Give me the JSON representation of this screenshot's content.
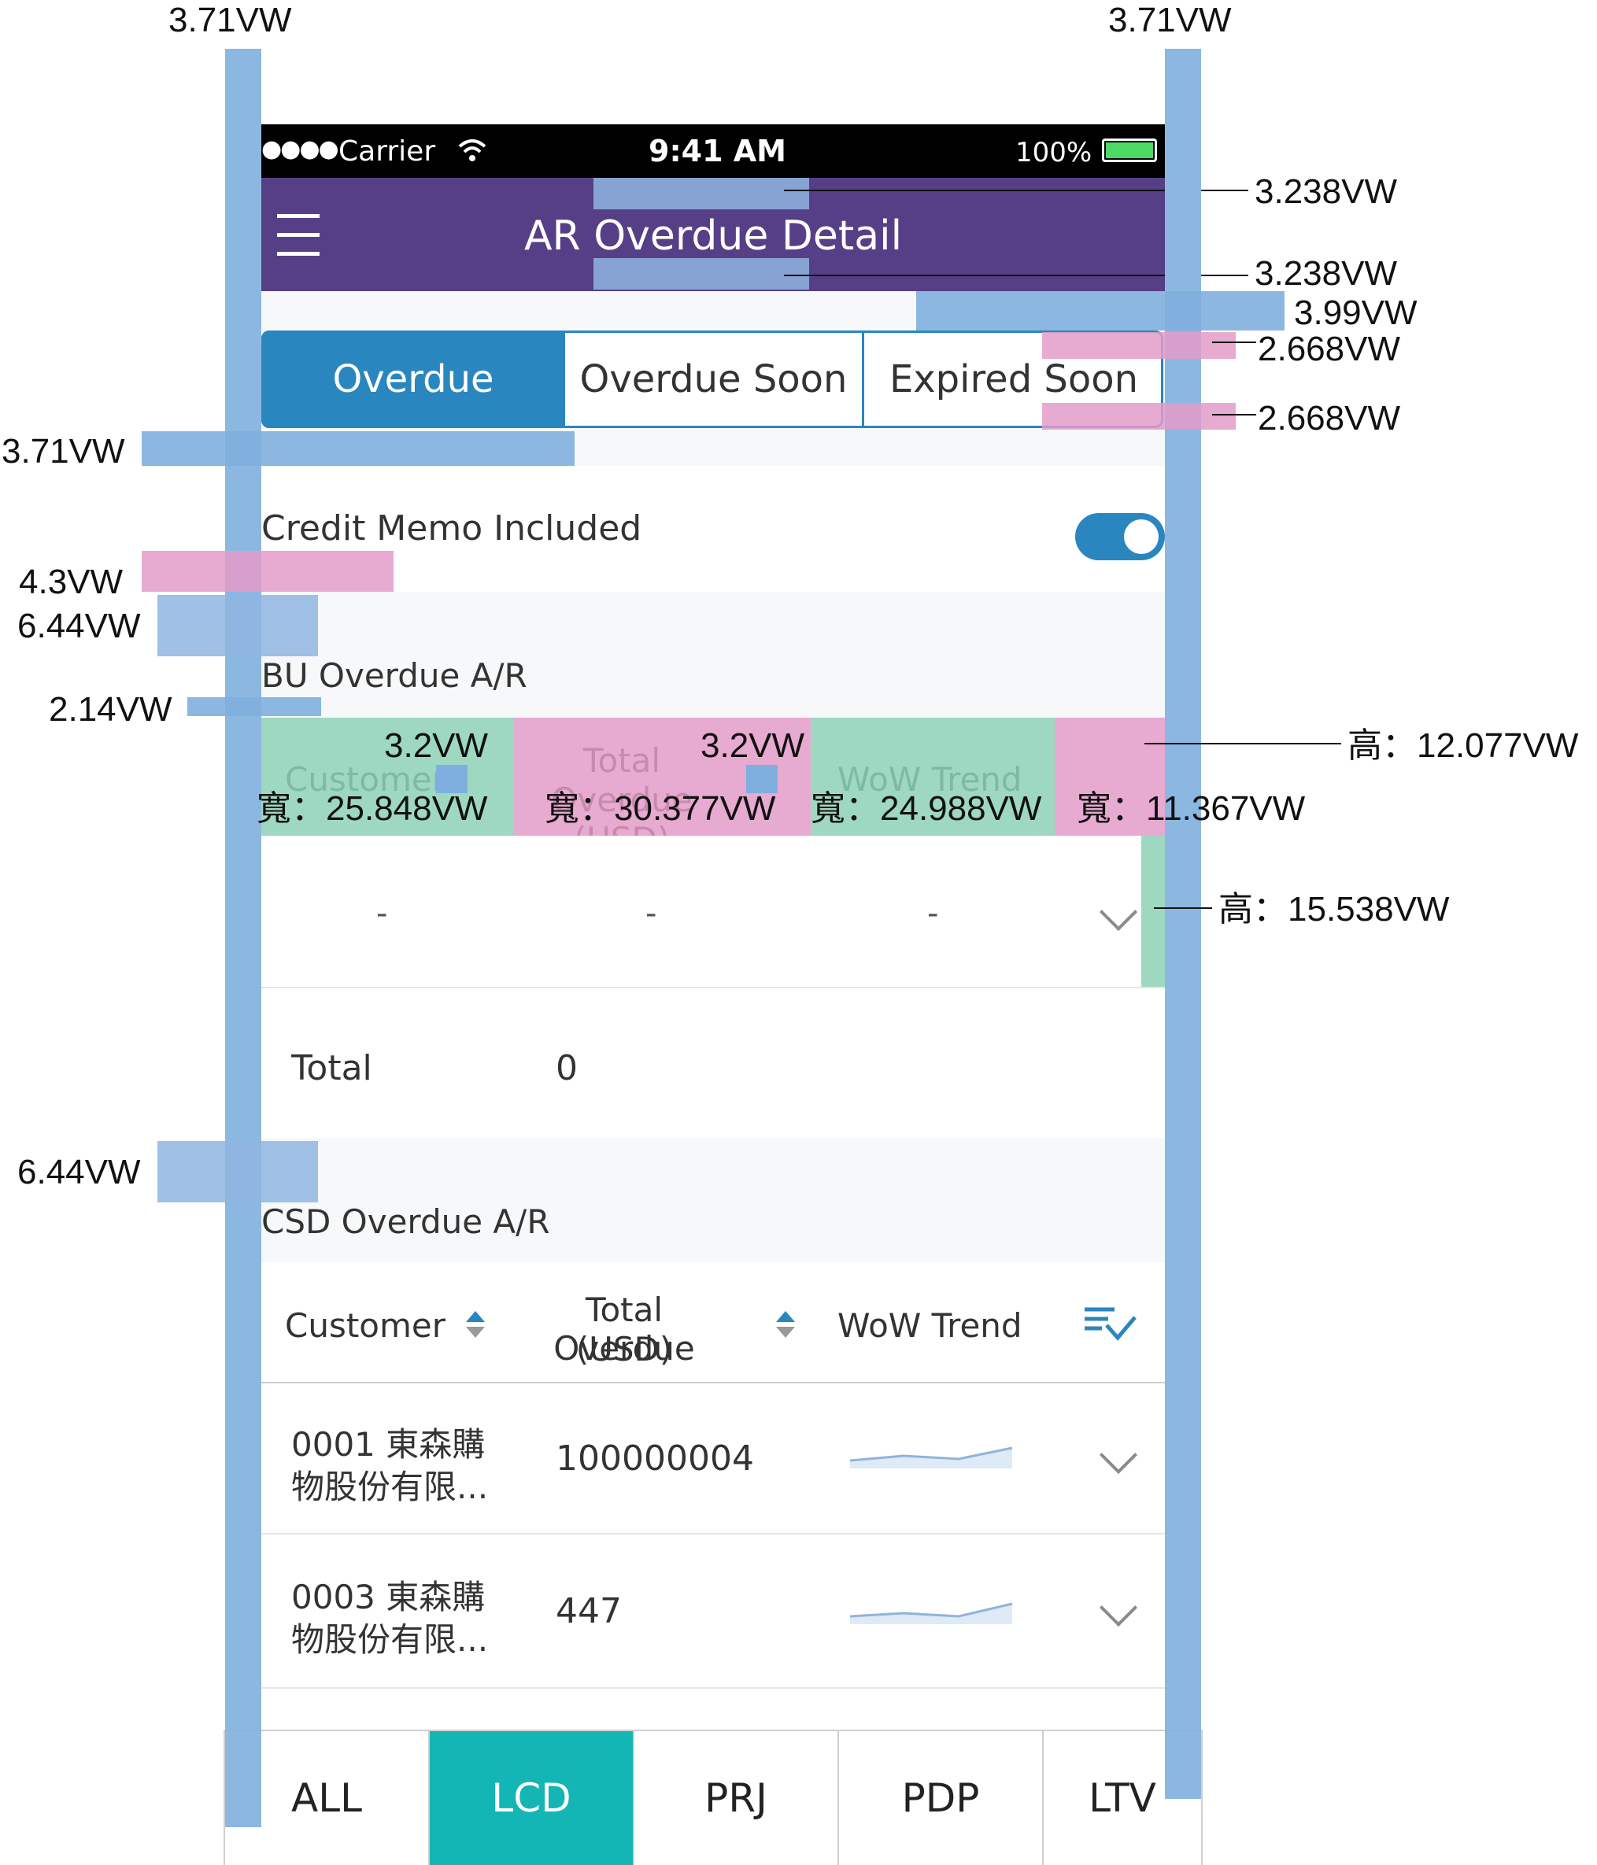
{
  "status_bar": {
    "signal": "●●●●",
    "carrier": "Carrier",
    "time": "9:41 AM",
    "battery": "100%"
  },
  "header": {
    "title": "AR Overdue Detail"
  },
  "segments": [
    {
      "label": "Overdue",
      "selected": true
    },
    {
      "label": "Overdue Soon",
      "selected": false
    },
    {
      "label": "Expired Soon",
      "selected": false
    }
  ],
  "toggle": {
    "label": "Credit Memo Included",
    "on": true
  },
  "bu_section": {
    "title": "BU Overdue A/R",
    "columns": [
      "Customer",
      "Total Overdue\n(USD)",
      "WoW Trend"
    ],
    "empty_row": [
      "-",
      "-",
      "-"
    ],
    "total_label": "Total",
    "total_value": "0"
  },
  "csd_section": {
    "title": "CSD Overdue A/R",
    "columns": {
      "customer": "Customer",
      "total_overdue_1": "Total Overdue",
      "total_overdue_2": "(USD)",
      "trend": "WoW Trend"
    },
    "rows": [
      {
        "customer_1": "0001 東森購",
        "customer_2": "物股份有限...",
        "value": "100000004"
      },
      {
        "customer_1": "0003 東森購",
        "customer_2": "物股份有限...",
        "value": "447"
      }
    ]
  },
  "tabbar": [
    {
      "label": "ALL",
      "selected": false
    },
    {
      "label": "LCD",
      "selected": true
    },
    {
      "label": "PRJ",
      "selected": false
    },
    {
      "label": "PDP",
      "selected": false
    },
    {
      "label": "LTV",
      "selected": false
    }
  ],
  "annotations": {
    "top_left": "3.71VW",
    "top_right": "3.71VW",
    "header_top": "3.238VW",
    "header_bottom": "3.238VW",
    "segment_gap": "3.99VW",
    "segment_top": "2.668VW",
    "segment_bottom": "2.668VW",
    "left_margin": "3.71VW",
    "toggle_gap": "4.3VW",
    "section_gap_1": "6.44VW",
    "title_gap": "2.14VW",
    "sort_size_1": "3.2VW",
    "sort_size_2": "3.2VW",
    "height_header": "高：12.077VW",
    "width_col1": "寬：25.848VW",
    "width_col2": "寬：30.377VW",
    "width_col3": "寬：24.988VW",
    "width_col4": "寬：11.367VW",
    "height_row": "高：15.538VW",
    "section_gap_2": "6.44VW"
  },
  "colors": {
    "header_bg": "#573f87",
    "segment_active": "#2a86bf",
    "tab_active": "#13b5b5",
    "toggle_on": "#2a86bf"
  }
}
